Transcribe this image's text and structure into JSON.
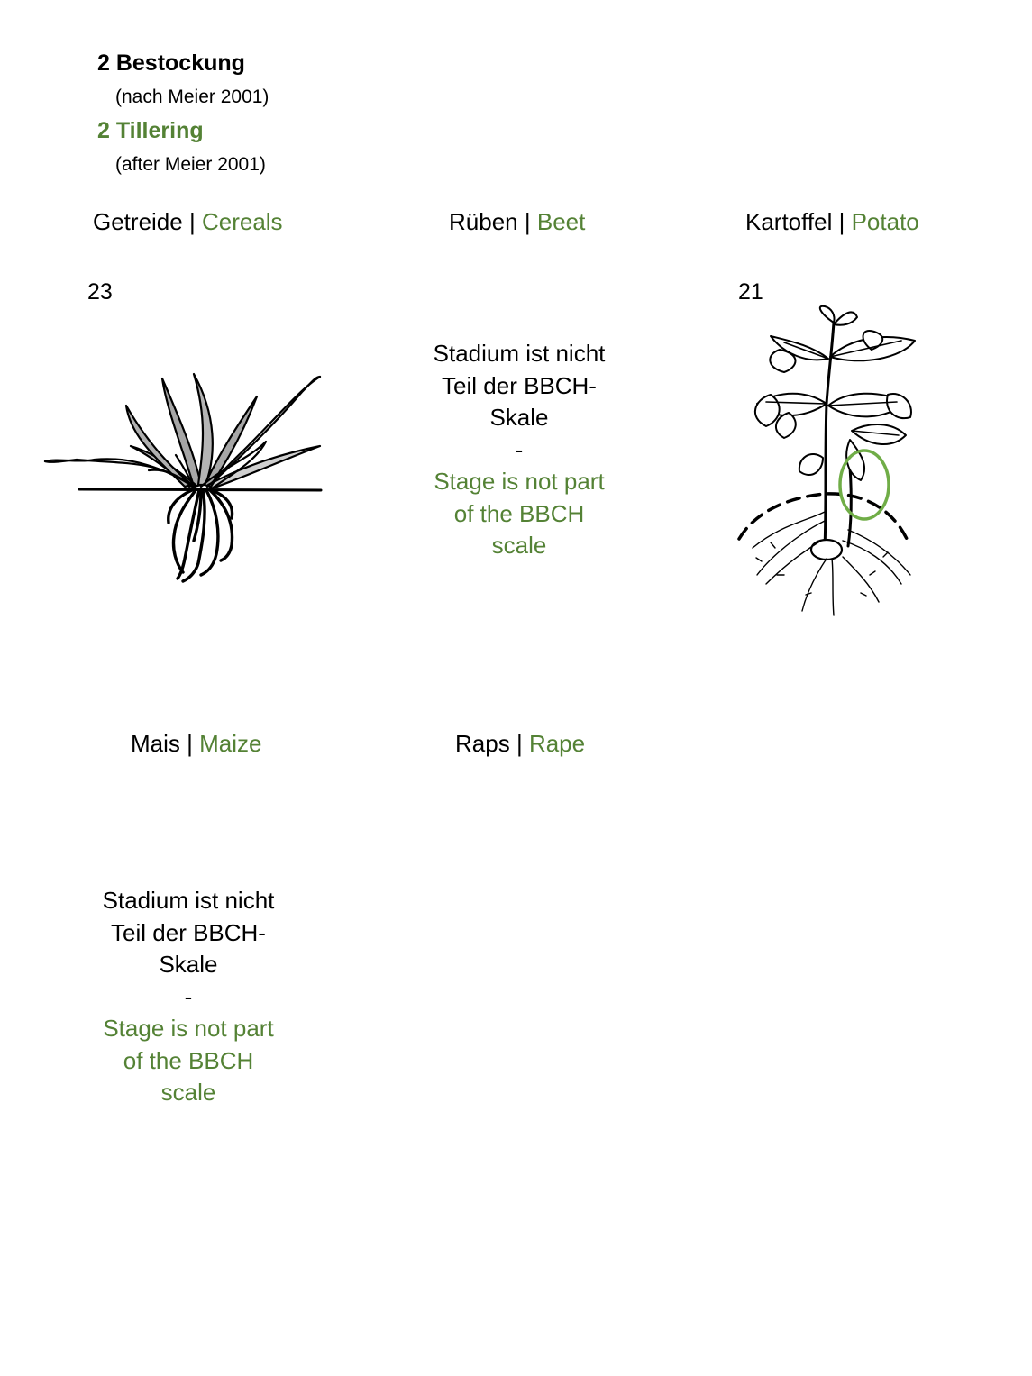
{
  "header": {
    "title_de": "2 Bestockung",
    "source_de": "(nach Meier 2001)",
    "title_en": "2 Tillering",
    "source_en": "(after Meier 2001)"
  },
  "crops": [
    {
      "name_de": "Getreide",
      "separator": "|",
      "name_en": "Cereals",
      "stage_code": "23"
    },
    {
      "name_de": "Rüben",
      "separator": "|",
      "name_en": "Beet",
      "note_de": [
        "Stadium ist nicht",
        "Teil der BBCH-",
        "Skale"
      ],
      "note_sep": "-",
      "note_en": [
        "Stage is not part",
        "of the BBCH",
        "scale"
      ]
    },
    {
      "name_de": "Kartoffel",
      "separator": "|",
      "name_en": "Potato",
      "stage_code": "21"
    },
    {
      "name_de": "Mais",
      "separator": "|",
      "name_en": "Maize",
      "note_de": [
        "Stadium ist nicht",
        "Teil der BBCH-",
        "Skale"
      ],
      "note_sep": "-",
      "note_en": [
        "Stage is not part",
        "of the BBCH",
        "scale"
      ]
    },
    {
      "name_de": "Raps",
      "separator": "|",
      "name_en": "Rape"
    }
  ],
  "colors": {
    "accent_green": "#548235",
    "highlight_ring": "#70ad47",
    "text": "#000000"
  },
  "icons": {
    "cereal": "cereal-tillering-drawing",
    "potato": "potato-plant-drawing",
    "highlight": "highlight-ellipse"
  }
}
